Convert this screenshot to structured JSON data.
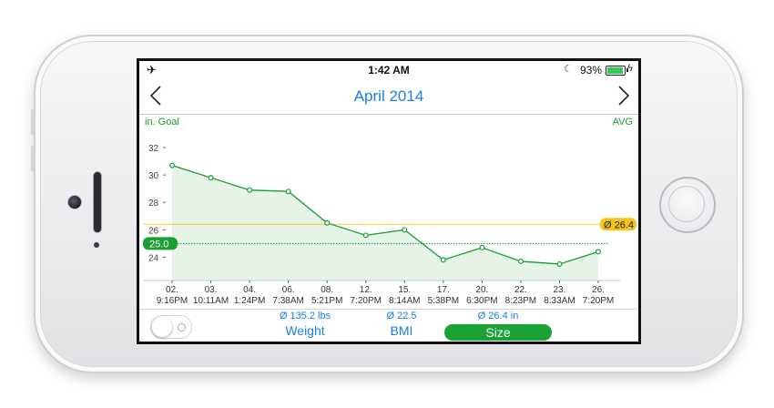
{
  "statusbar": {
    "airplane_icon": "airplane-icon",
    "time": "1:42 AM",
    "moon_icon": "moon-icon",
    "battery_percent": "93%",
    "battery_level": 0.93,
    "charging_icon": "bolt-icon"
  },
  "navbar": {
    "title": "April 2014",
    "prev_icon": "chevron-left-icon",
    "next_icon": "chevron-right-icon"
  },
  "chart": {
    "legend_left": "in. Goal",
    "legend_right": "AVG"
  },
  "chart_data": {
    "type": "area",
    "ylabel": "in.",
    "ylim": [
      22.3,
      33.2
    ],
    "yticks": [
      24,
      26,
      28,
      30,
      32
    ],
    "x": [
      "02.\n9:16PM",
      "03.\n10:11AM",
      "04.\n1:24PM",
      "06.\n7:38AM",
      "08.\n5:21PM",
      "12.\n7:20PM",
      "15.\n8:14AM",
      "17.\n5:38PM",
      "20.\n6:30PM",
      "22.\n8:23PM",
      "23.\n8:33AM",
      "26.\n7:20PM"
    ],
    "series": [
      {
        "values": [
          30.7,
          29.8,
          28.9,
          28.8,
          26.5,
          25.6,
          26.0,
          23.8,
          24.7,
          23.7,
          23.5,
          24.4
        ]
      }
    ],
    "goal": {
      "value": 25.0,
      "label": "25.0",
      "color": "#1a9d33"
    },
    "average": {
      "value": 26.4,
      "label": "Ø 26.4",
      "color": "#f5c518"
    },
    "colors": {
      "line": "#1a9d33",
      "fill": "#e5f4e7",
      "grid": "#c8c8cc"
    }
  },
  "bottom": {
    "toggle_on": false,
    "tabs": [
      {
        "avg": "Ø 135.2 lbs",
        "label": "Weight",
        "selected": false
      },
      {
        "avg": "Ø 22.5",
        "label": "BMI",
        "selected": false
      },
      {
        "avg": "Ø 26.4 in",
        "label": "Size",
        "selected": true
      }
    ]
  }
}
